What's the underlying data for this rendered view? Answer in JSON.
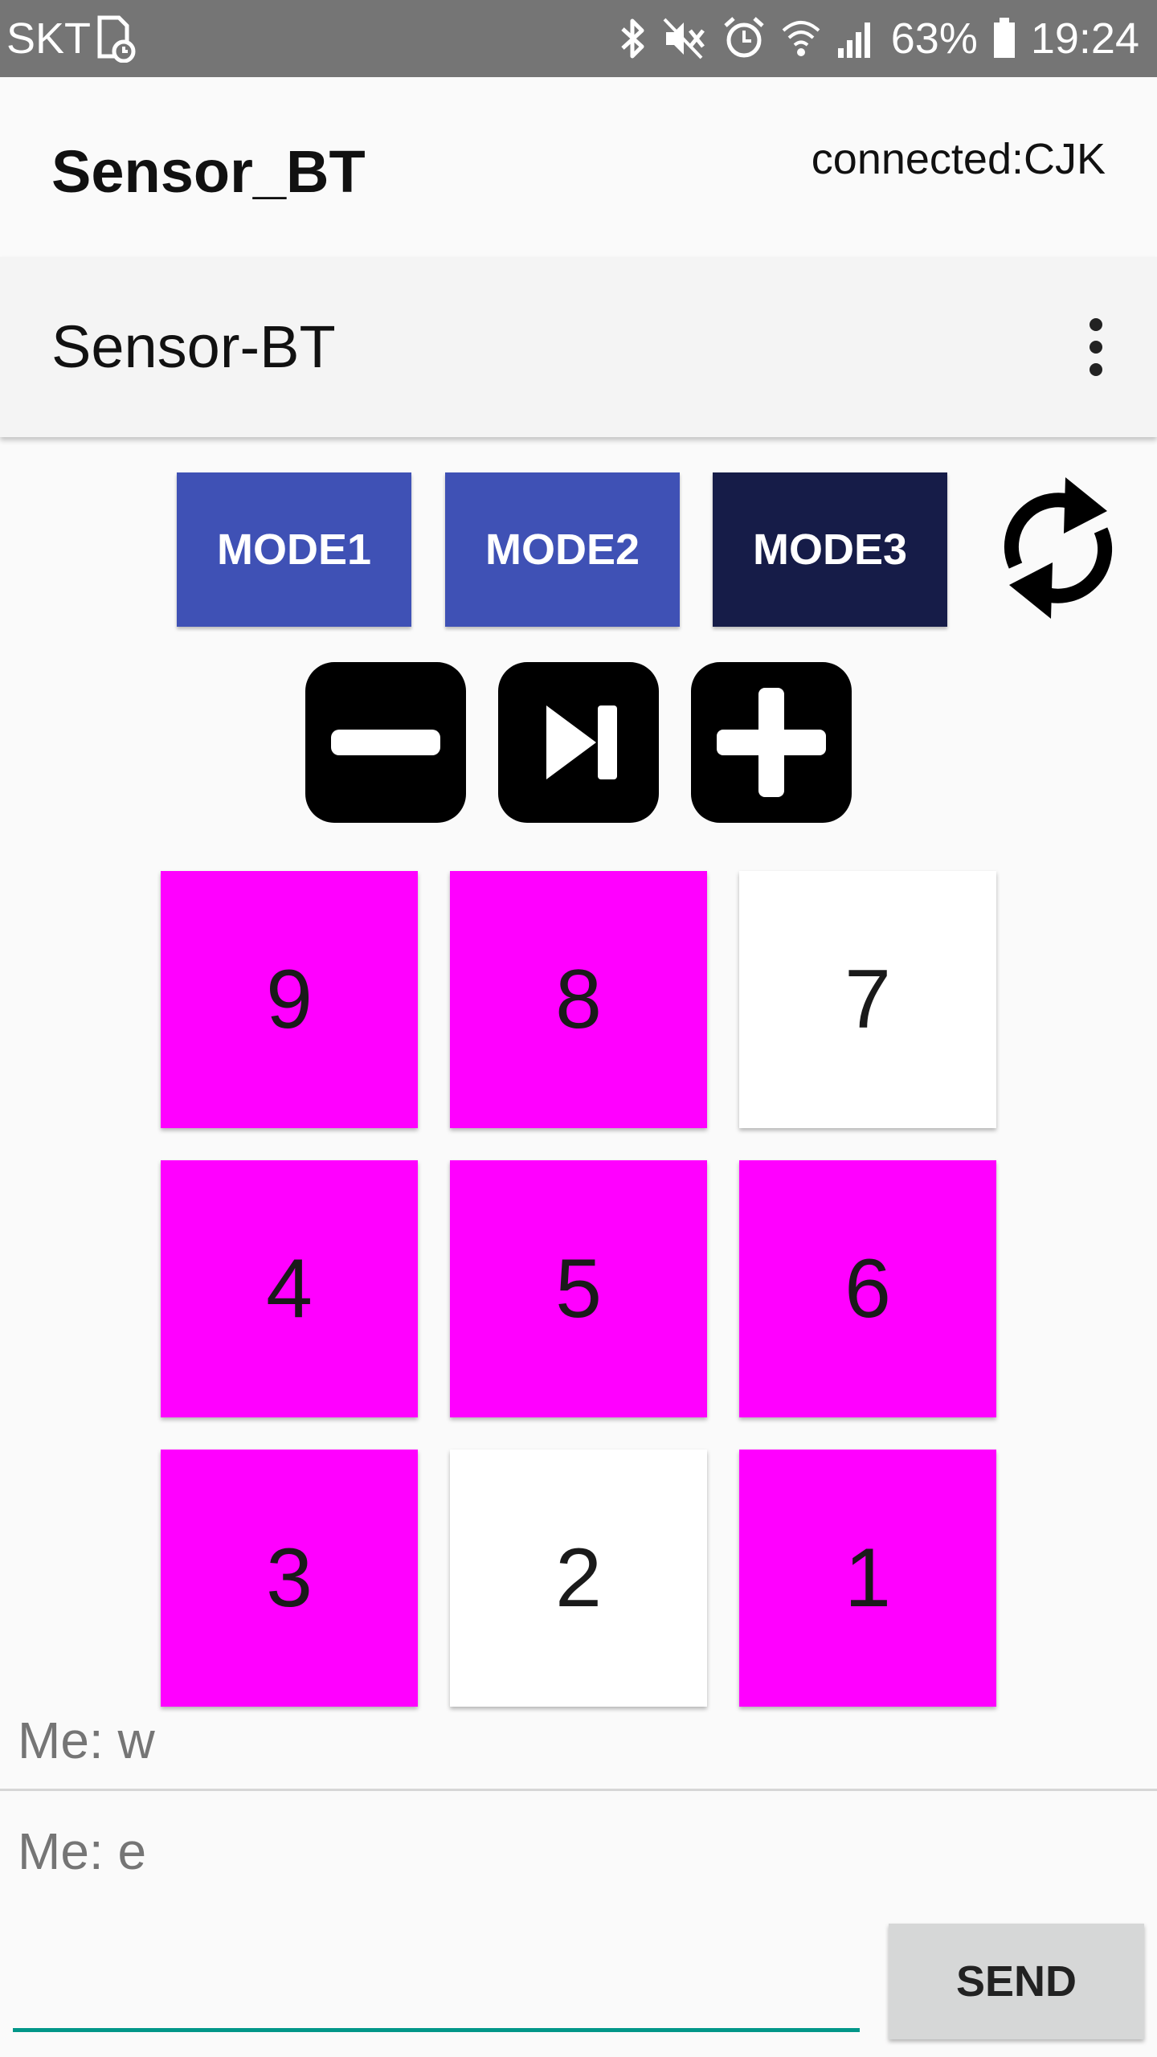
{
  "status_bar": {
    "carrier": "SKT",
    "battery_percent": "63%",
    "time": "19:24",
    "icons": [
      "sim-card-icon",
      "bluetooth-icon",
      "mute-vibrate-icon",
      "alarm-icon",
      "wifi-icon",
      "signal-icon",
      "battery-icon"
    ]
  },
  "app": {
    "title": "Sensor_BT",
    "connection_status": "connected:CJK"
  },
  "toolbar": {
    "title": "Sensor-BT",
    "menu_icon": "overflow-menu-icon"
  },
  "modes": [
    {
      "label": "MODE1",
      "color": "#3f51b5"
    },
    {
      "label": "MODE2",
      "color": "#3f51b5"
    },
    {
      "label": "MODE3",
      "color": "#161c48"
    }
  ],
  "controls": [
    "minus-icon",
    "skip-next-icon",
    "plus-icon"
  ],
  "grid": {
    "active_color": "#ff00ff",
    "inactive_color": "#ffffff",
    "tiles": [
      {
        "label": "9",
        "active": true
      },
      {
        "label": "8",
        "active": true
      },
      {
        "label": "7",
        "active": false
      },
      {
        "label": "4",
        "active": true
      },
      {
        "label": "5",
        "active": true
      },
      {
        "label": "6",
        "active": true
      },
      {
        "label": "3",
        "active": true
      },
      {
        "label": "2",
        "active": false
      },
      {
        "label": "1",
        "active": true
      }
    ]
  },
  "messages": [
    {
      "text": "Me:  w"
    },
    {
      "text": "Me:  e"
    }
  ],
  "input": {
    "value": "",
    "placeholder": ""
  },
  "send_label": "SEND",
  "accent_color": "#009688"
}
